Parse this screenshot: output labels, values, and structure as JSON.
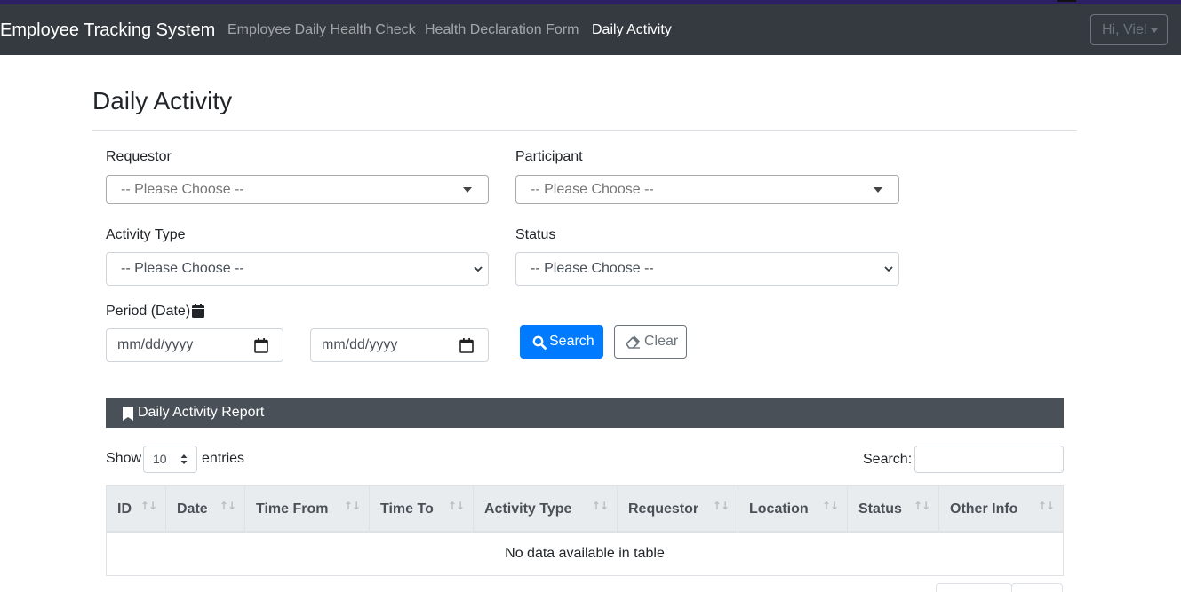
{
  "navbar": {
    "brand": "Employee Tracking System",
    "links": [
      "Employee Daily Health Check",
      "Health Declaration Form",
      "Daily Activity"
    ],
    "active_index": 2,
    "user_button": "Hi, Viel"
  },
  "page": {
    "title": "Daily Activity"
  },
  "filters": {
    "requestor": {
      "label": "Requestor",
      "value": "-- Please Choose --"
    },
    "participant": {
      "label": "Participant",
      "value": "-- Please Choose --"
    },
    "activity_type": {
      "label": "Activity Type",
      "value": "-- Please Choose --"
    },
    "status": {
      "label": "Status",
      "value": "-- Please Choose --"
    },
    "period": {
      "label": "Period (Date)",
      "from_placeholder": "mm/dd/yyyy",
      "to_placeholder": "mm/dd/yyyy"
    },
    "search_button": "Search",
    "clear_button": "Clear"
  },
  "report": {
    "title": "Daily Activity Report",
    "show_label": "Show",
    "page_length": "10",
    "entries_label": "entries",
    "search_label": "Search:",
    "columns": [
      "ID",
      "Date",
      "Time From",
      "Time To",
      "Activity Type",
      "Requestor",
      "Location",
      "Status",
      "Other Info"
    ],
    "empty_message": "No data available in table"
  },
  "colors": {
    "navbar": "#343a40",
    "primary": "#007bff",
    "report_header": "#495057",
    "table_header": "#e9ecef"
  },
  "icons": [
    "calendar-icon",
    "search-icon",
    "eraser-icon",
    "bookmark-icon",
    "sort-icon",
    "chevron-down-icon"
  ]
}
